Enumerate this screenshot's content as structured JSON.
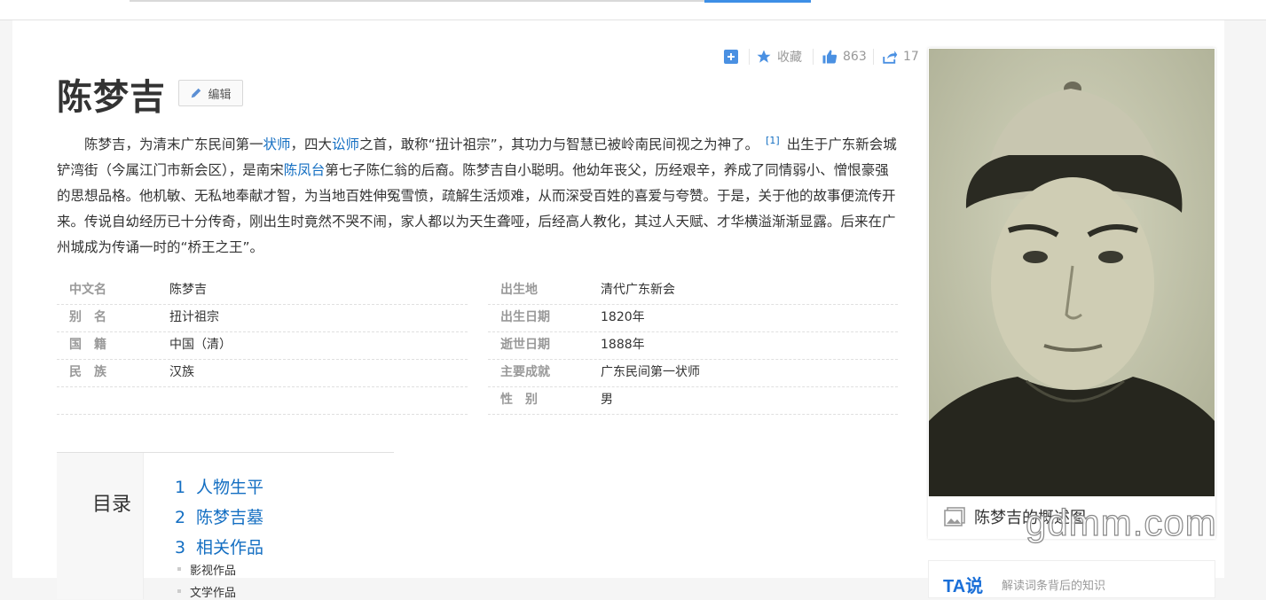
{
  "header": {
    "edit_label": "编辑"
  },
  "toolbar": {
    "favorite_label": "收藏",
    "like_count": "863",
    "share_count": "17"
  },
  "entry": {
    "title": "陈梦吉",
    "intro": {
      "p1": "陈梦吉，为清末广东民间第一",
      "link1": "状师",
      "p2": "，四大",
      "link2": "讼师",
      "p3": "之首，敢称“扭计祖宗”，其功力与智慧已被岭南民间视之为神了。",
      "ref": "[1]",
      "p4": "出生于广东新会城铲湾街（今属江门市新会区），是南宋",
      "link3": "陈凤台",
      "p5": "第七子陈仁翁的后裔。陈梦吉自小聪明。他幼年丧父，历经艰辛，养成了同情弱小、憎恨豪强的思想品格。他机敏、无私地奉献才智，为当地百姓伸冤雪愤，疏解生活烦难，从而深受百姓的喜爱与夸赞。于是，关于他的故事便流传开来。传说自幼经历已十分传奇，刚出生时竟然不哭不闹，家人都以为天生聋哑，后经高人教化，其过人天赋、才华横溢渐渐显露。后来在广州城成为传诵一时的“桥王之王”。"
    }
  },
  "basic_info": {
    "left": [
      {
        "name": "中文名",
        "value": "陈梦吉"
      },
      {
        "name": "别　名",
        "value": "扭计祖宗"
      },
      {
        "name": "国　籍",
        "value": "中国（清）"
      },
      {
        "name": "民　族",
        "value": "汉族"
      }
    ],
    "right": [
      {
        "name": "出生地",
        "value": "清代广东新会"
      },
      {
        "name": "出生日期",
        "value": "1820年"
      },
      {
        "name": "逝世日期",
        "value": "1888年"
      },
      {
        "name": "主要成就",
        "value": "广东民间第一状师"
      },
      {
        "name": "性　别",
        "value": "男"
      }
    ]
  },
  "catalog": {
    "title": "目录",
    "items": [
      {
        "num": "1",
        "label": "人物生平"
      },
      {
        "num": "2",
        "label": "陈梦吉墓"
      },
      {
        "num": "3",
        "label": "相关作品"
      }
    ],
    "subitems": [
      "影视作品",
      "文学作品"
    ]
  },
  "album": {
    "caption": "陈梦吉的概述图"
  },
  "tashuo": {
    "logo": "TA说",
    "text": "解读词条背后的知识"
  },
  "watermark": "gdmm.com"
}
